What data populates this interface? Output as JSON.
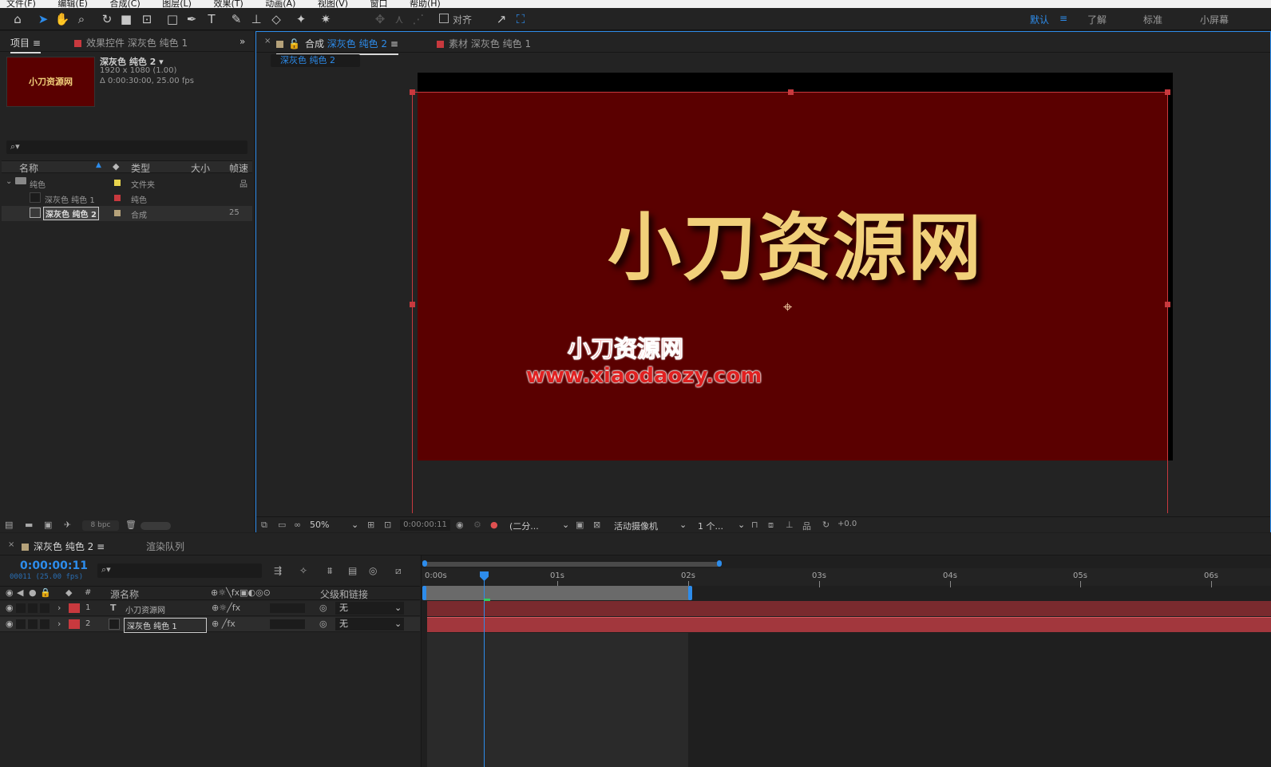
{
  "menubar": [
    "文件(F)",
    "编辑(E)",
    "合成(C)",
    "图层(L)",
    "效果(T)",
    "动画(A)",
    "视图(V)",
    "窗口",
    "帮助(H)"
  ],
  "toolbar": {
    "snap_label": "对齐",
    "workspaces": [
      "默认",
      "了解",
      "标准",
      "小屏幕"
    ],
    "active_workspace": "默认"
  },
  "project": {
    "tab_label": "项目",
    "effects_tab": "效果控件 深灰色 纯色 1",
    "thumb_text": "小刀资源网",
    "item_name": "深灰色 纯色 2",
    "item_size": "1920 x 1080 (1.00)",
    "item_duration": "Δ 0:00:30:00, 25.00 fps",
    "columns": [
      "名称",
      "类型",
      "大小",
      "帧速"
    ],
    "rows": [
      {
        "name": "纯色",
        "type": "文件夹",
        "size": "",
        "color": "#e8d44d"
      },
      {
        "name": "深灰色 纯色 1",
        "type": "纯色",
        "size": "",
        "color": "#c8393e"
      },
      {
        "name": "深灰色 纯色 2",
        "type": "合成",
        "size": "25",
        "color": "#b5a27a"
      }
    ],
    "bpc": "8 bpc"
  },
  "viewer": {
    "comp_tab_prefix": "合成",
    "comp_tab_name": "深灰色 纯色 2",
    "footage_tab": "素材 深灰色 纯色 1",
    "subtab": "深灰色 纯色 2",
    "big_title": "小刀资源网",
    "watermark_cn": "小刀资源网",
    "watermark_url": "www.xiaodaozy.com",
    "zoom": "50%",
    "timecode": "0:00:00:11",
    "resolution": "(二分...",
    "camera": "活动摄像机",
    "views": "1 个...",
    "exposure": "+0.0",
    "bg_color": "#5a0000",
    "title_color": "#f1d07a"
  },
  "timeline": {
    "tab_label": "深灰色 纯色 2",
    "render_tab": "渲染队列",
    "current_time": "0:00:00:11",
    "frame_info": "00011 (25.00 fps)",
    "col_source": "源名称",
    "col_parent": "父级和链接",
    "col_num": "#",
    "ruler": [
      "0:00s",
      "01s",
      "02s",
      "03s",
      "04s",
      "05s",
      "06s"
    ],
    "layers": [
      {
        "num": "1",
        "type": "T",
        "name": "小刀资源网",
        "parent": "无",
        "color": "#c8393e"
      },
      {
        "num": "2",
        "type": "",
        "name": "深灰色 纯色 1",
        "parent": "无",
        "color": "#c8393e"
      }
    ]
  }
}
